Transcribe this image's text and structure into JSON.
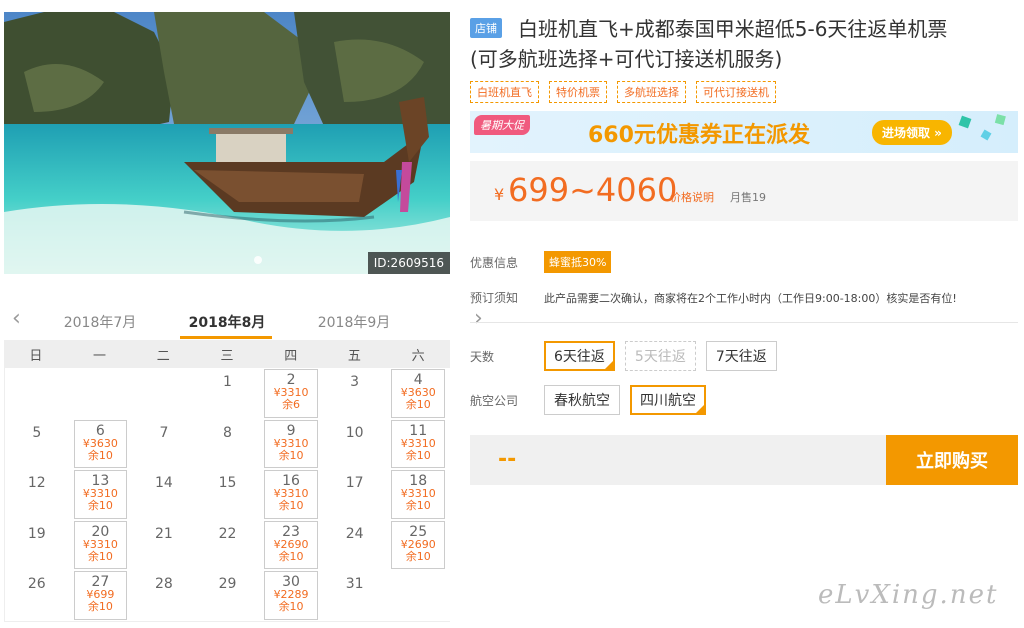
{
  "hero": {
    "image_id": "ID:2609516",
    "colors": {
      "sky": "#6ba3d6",
      "water": "#3fc9c4",
      "sand": "#e8f4f0",
      "rock": "#4b5a3a"
    }
  },
  "calendar": {
    "prev_month": "2018年7月",
    "current_month": "2018年8月",
    "next_month": "2018年9月",
    "weekdays": [
      "日",
      "一",
      "二",
      "三",
      "四",
      "五",
      "六"
    ],
    "days": [
      {
        "d": ""
      },
      {
        "d": ""
      },
      {
        "d": ""
      },
      {
        "d": "1"
      },
      {
        "d": "2",
        "price": "¥3310",
        "left": "余6"
      },
      {
        "d": "3"
      },
      {
        "d": "4",
        "price": "¥3630",
        "left": "余10"
      },
      {
        "d": "5"
      },
      {
        "d": "6",
        "price": "¥3630",
        "left": "余10"
      },
      {
        "d": "7"
      },
      {
        "d": "8"
      },
      {
        "d": "9",
        "price": "¥3310",
        "left": "余10"
      },
      {
        "d": "10"
      },
      {
        "d": "11",
        "price": "¥3310",
        "left": "余10"
      },
      {
        "d": "12"
      },
      {
        "d": "13",
        "price": "¥3310",
        "left": "余10"
      },
      {
        "d": "14"
      },
      {
        "d": "15"
      },
      {
        "d": "16",
        "price": "¥3310",
        "left": "余10"
      },
      {
        "d": "17"
      },
      {
        "d": "18",
        "price": "¥3310",
        "left": "余10"
      },
      {
        "d": "19"
      },
      {
        "d": "20",
        "price": "¥3310",
        "left": "余10"
      },
      {
        "d": "21"
      },
      {
        "d": "22"
      },
      {
        "d": "23",
        "price": "¥2690",
        "left": "余10"
      },
      {
        "d": "24"
      },
      {
        "d": "25",
        "price": "¥2690",
        "left": "余10"
      },
      {
        "d": "26"
      },
      {
        "d": "27",
        "price": "¥699",
        "left": "余10"
      },
      {
        "d": "28"
      },
      {
        "d": "29"
      },
      {
        "d": "30",
        "price": "¥2289",
        "left": "余10"
      },
      {
        "d": "31"
      },
      {
        "d": ""
      }
    ]
  },
  "product": {
    "shop_tag": "店铺",
    "title_line1": "白班机直飞+成都泰国甲米超低5-6天往返单机票",
    "title_line2": "(可多航班选择+可代订接送机服务)",
    "tags": [
      "白班机直飞",
      "特价机票",
      "多航班选择",
      "可代订接送机"
    ],
    "banner": {
      "promo_label": "暑期大促",
      "amount": "660元",
      "message": "优惠券正在派发",
      "enter_label": "进场领取 »"
    },
    "price": {
      "currency": "¥",
      "range": "699~4060",
      "explain": "价格说明",
      "sales": "月售19"
    },
    "discount_label": "优惠信息",
    "discount_badge": "蜂蜜抵30%",
    "notice_label": "预订须知",
    "notice_text": "此产品需要二次确认，商家将在2个工作小时内（工作日9:00-18:00）核实是否有位!",
    "days_label": "天数",
    "days_options": [
      "6天往返",
      "5天往返",
      "7天往返"
    ],
    "airline_label": "航空公司",
    "airline_options": [
      "春秋航空",
      "四川航空"
    ],
    "total_placeholder": "--",
    "buy_label": "立即购买"
  },
  "watermark": "eLvXing.net",
  "theme": {
    "accent": "#f39800",
    "price": "#f26c21",
    "tag_blue": "#5aa0e6"
  }
}
